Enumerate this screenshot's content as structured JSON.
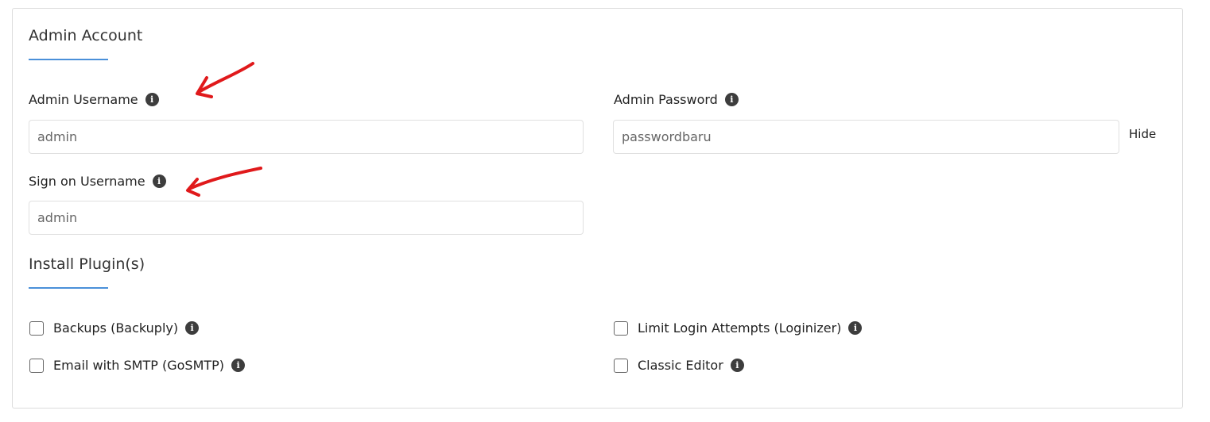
{
  "admin_account": {
    "title": "Admin Account",
    "username_label": "Admin Username",
    "username_value": "admin",
    "password_label": "Admin Password",
    "password_value": "passwordbaru",
    "hide_label": "Hide",
    "signon_label": "Sign on Username",
    "signon_value": "admin"
  },
  "plugins": {
    "title": "Install Plugin(s)",
    "items": [
      {
        "label": "Backups (Backuply)",
        "checked": false
      },
      {
        "label": "Limit Login Attempts (Loginizer)",
        "checked": false
      },
      {
        "label": "Email with SMTP (GoSMTP)",
        "checked": false
      },
      {
        "label": "Classic Editor",
        "checked": false
      }
    ]
  },
  "icons": {
    "info": "info-icon",
    "annotation": "red-arrow-annotation"
  },
  "colors": {
    "accent_underline": "#4a90d9",
    "annotation_red": "#e0191b",
    "info_icon_bg": "#3d3d3d"
  }
}
